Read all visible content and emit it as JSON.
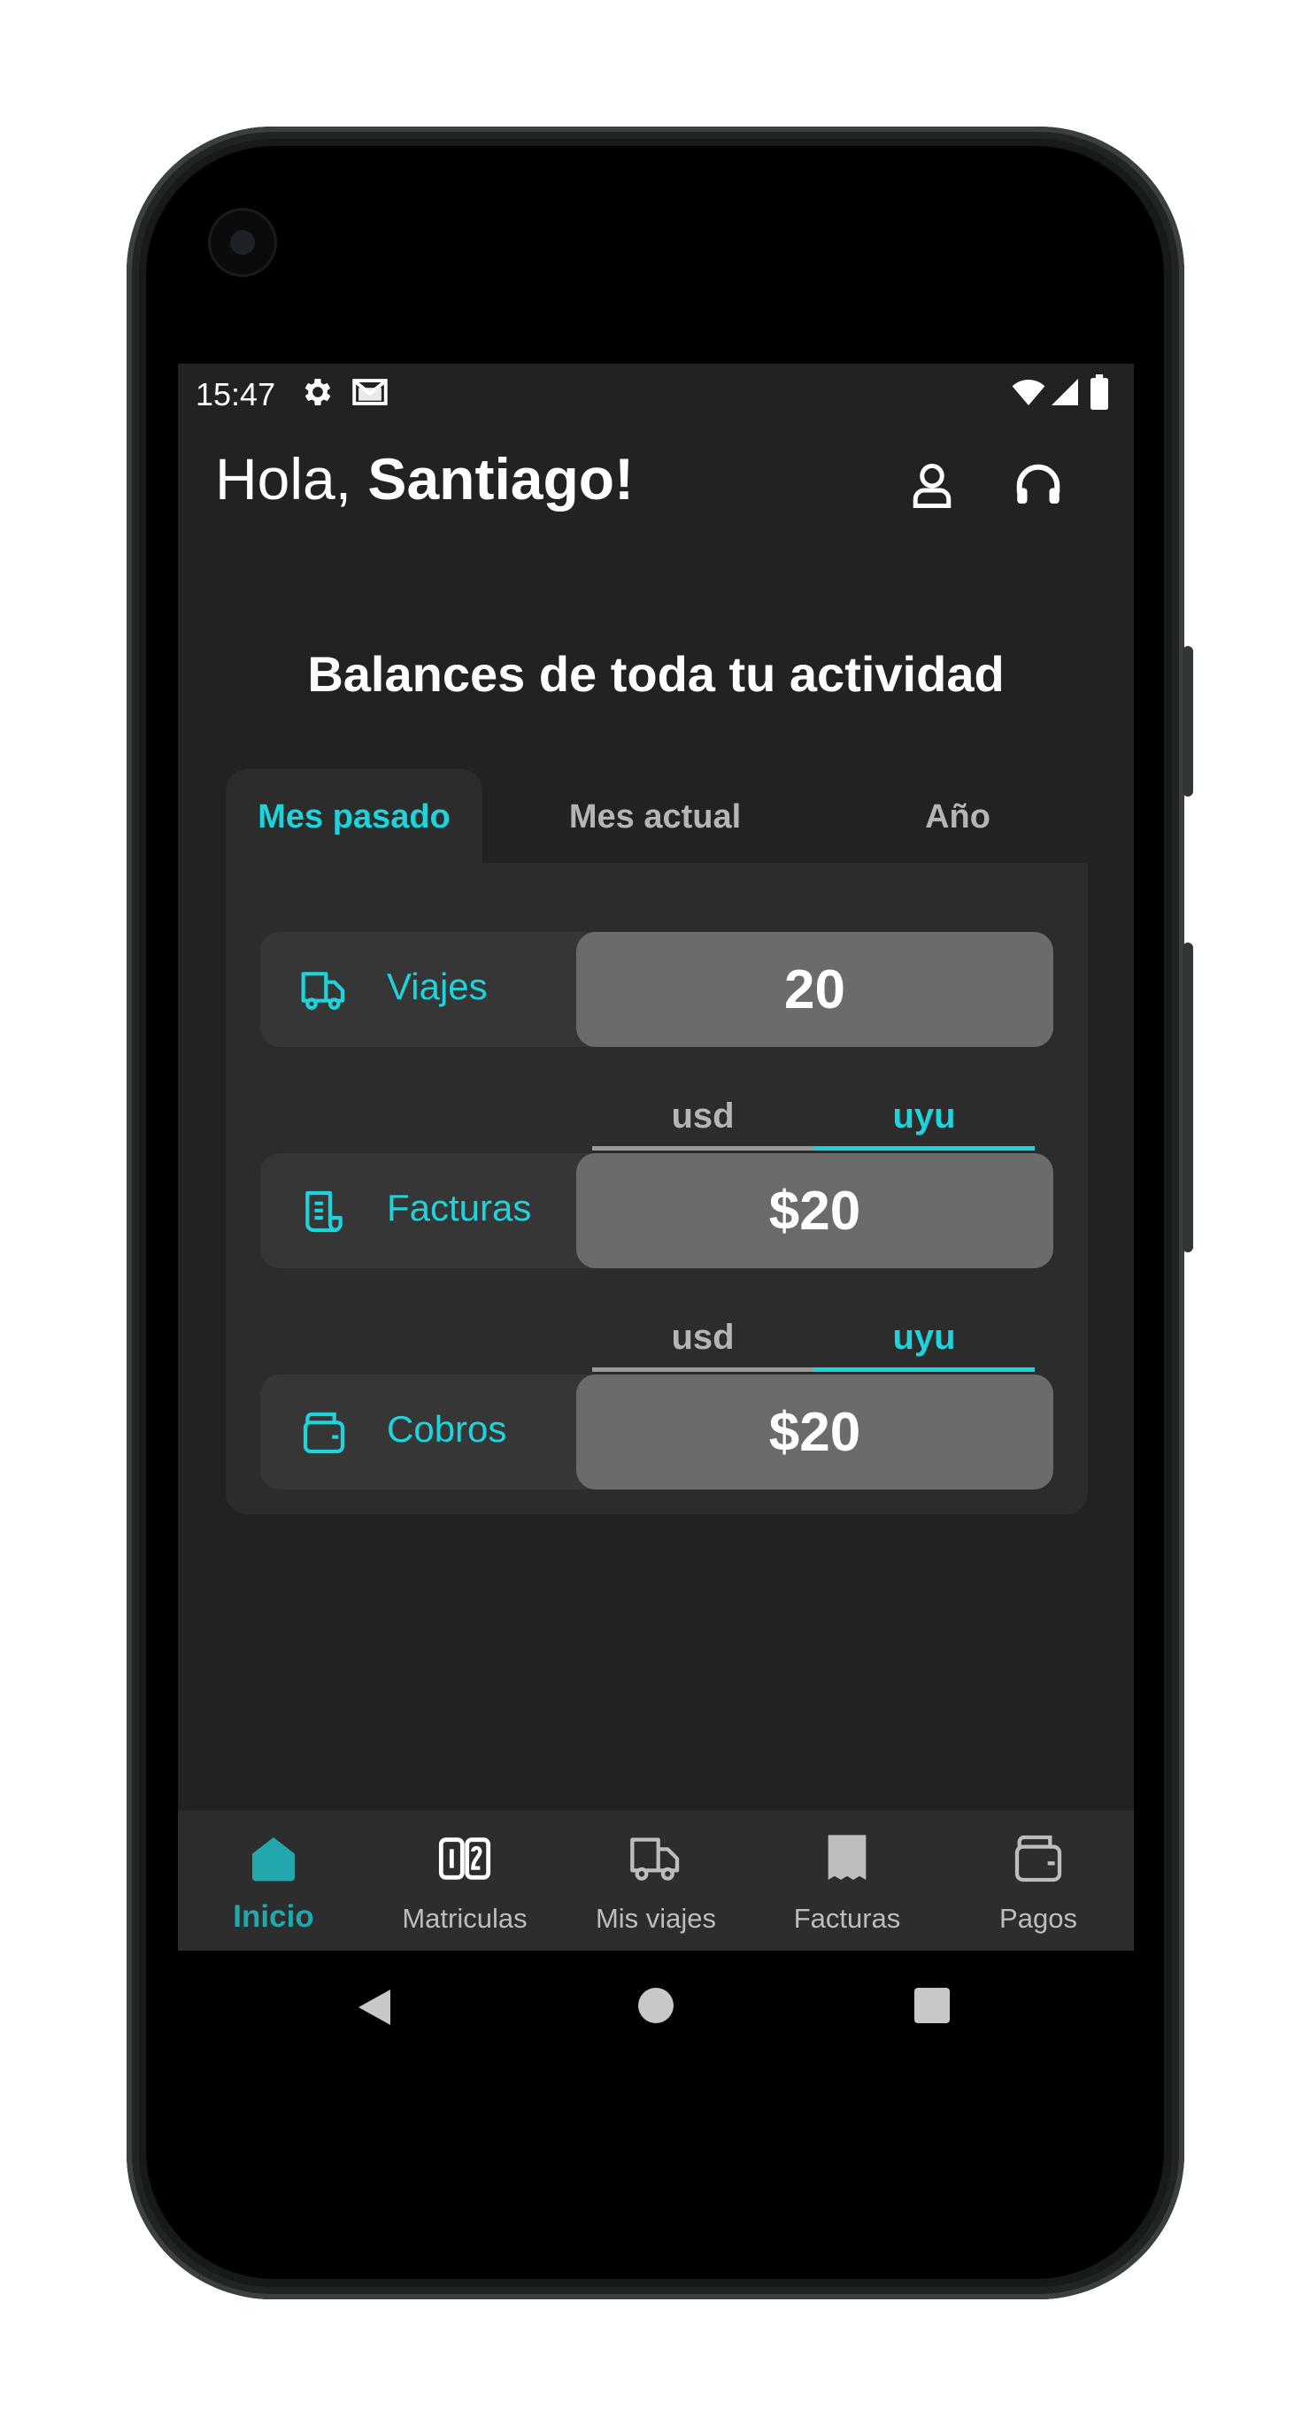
{
  "status_bar": {
    "time": "15:47"
  },
  "header": {
    "greeting_prefix": "Hola, ",
    "user_name": "Santiago!"
  },
  "page_title": "Balances de toda tu actividad",
  "tabs": [
    {
      "label": "Mes pasado",
      "active": true
    },
    {
      "label": "Mes actual",
      "active": false
    },
    {
      "label": "Año",
      "active": false
    }
  ],
  "rows": {
    "viajes": {
      "label": "Viajes",
      "value": "20",
      "icon": "truck-icon"
    },
    "facturas": {
      "label": "Facturas",
      "value": "$20",
      "icon": "receipt-icon",
      "currency": {
        "options": [
          "usd",
          "uyu"
        ],
        "selected": "uyu"
      }
    },
    "cobros": {
      "label": "Cobros",
      "value": "$20",
      "icon": "wallet-icon",
      "currency": {
        "options": [
          "usd",
          "uyu"
        ],
        "selected": "uyu"
      }
    }
  },
  "bottom_nav": [
    {
      "label": "Inicio",
      "icon": "home-icon",
      "active": true
    },
    {
      "label": "Matriculas",
      "icon": "license-plate-icon",
      "active": false
    },
    {
      "label": "Mis viajes",
      "icon": "truck-icon",
      "active": false
    },
    {
      "label": "Facturas",
      "icon": "receipt-icon",
      "active": false
    },
    {
      "label": "Pagos",
      "icon": "wallet-icon",
      "active": false
    }
  ],
  "colors": {
    "accent": "#1fd3dc",
    "background": "#222222",
    "card": "#2c2c2c",
    "value_box": "#6b6b6b",
    "nav_active": "#22a8ac"
  }
}
